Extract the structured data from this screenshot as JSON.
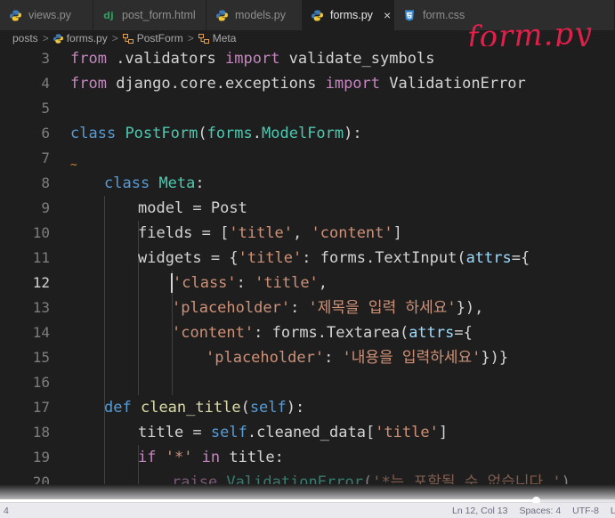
{
  "tabs": [
    {
      "label": "views.py",
      "icon": "python-icon",
      "active": false
    },
    {
      "label": "post_form.html",
      "icon": "django-icon",
      "icon_text": "dj",
      "active": false
    },
    {
      "label": "models.py",
      "icon": "python-icon",
      "active": false
    },
    {
      "label": "forms.py",
      "icon": "python-icon",
      "active": true,
      "close": "×"
    },
    {
      "label": "form.css",
      "icon": "css-icon",
      "active": false
    }
  ],
  "breadcrumb": {
    "items": [
      "posts",
      "forms.py",
      "PostForm",
      "Meta"
    ],
    "separator": ">"
  },
  "annotation": "form.py",
  "gutter": {
    "line_numbers": [
      "3",
      "4",
      "5",
      "6",
      "7",
      "8",
      "9",
      "10",
      "11",
      "12",
      "13",
      "14",
      "15",
      "16",
      "17",
      "18",
      "19",
      "20"
    ],
    "current_line": "12"
  },
  "code": {
    "l3": {
      "kw_from": "from",
      "mod": " .validators ",
      "kw_import": "import",
      "name": " validate_symbols"
    },
    "l4": {
      "kw_from": "from",
      "mod": " django.core.exceptions ",
      "kw_import": "import",
      "name": " ValidationError"
    },
    "l6": {
      "kw": "class",
      "name": "PostForm",
      "p1": "(",
      "base_mod": "forms",
      "dot": ".",
      "base": "ModelForm",
      "p2": "):"
    },
    "l7": {
      "marker": "~"
    },
    "l8": {
      "kw": "class",
      "name": "Meta",
      "colon": ":"
    },
    "l9": {
      "var": "model",
      "eq": " = ",
      "val": "Post"
    },
    "l10": {
      "var": "fields",
      "eq": " = [",
      "s1": "'title'",
      "comma": ", ",
      "s2": "'content'",
      "end": "]"
    },
    "l11": {
      "var": "widgets",
      "eq": " = {",
      "s1": "'title'",
      "colon": ": ",
      "mod": "forms",
      "dot": ".",
      "cls": "TextInput",
      "p": "(",
      "arg": "attrs",
      "end": "={"
    },
    "l12": {
      "s1": "'class'",
      "colon": ": ",
      "s2": "'title'",
      "end": ","
    },
    "l13": {
      "s1": "'placeholder'",
      "colon": ": ",
      "s2": "'제목을 입력 하세요'",
      "end": "}),"
    },
    "l14": {
      "s1": "'content'",
      "colon": ": ",
      "mod": "forms",
      "dot": ".",
      "cls": "Textarea",
      "p": "(",
      "arg": "attrs",
      "end": "={"
    },
    "l15": {
      "s1": "'placeholder'",
      "colon": ": ",
      "s2": "'내용을 입력하세요'",
      "end": "})}"
    },
    "l17": {
      "kw": "def",
      "fn": "clean_title",
      "p1": "(",
      "self": "self",
      "p2": "):"
    },
    "l18": {
      "var": "title",
      "eq": " = ",
      "self": "self",
      "dot": ".",
      "attr": "cleaned_data",
      "b1": "[",
      "s1": "'title'",
      "b2": "]"
    },
    "l19": {
      "kw": "if",
      "s1": " '*' ",
      "kw2": "in",
      "rest": " title:"
    },
    "l20": {
      "fn": "raise",
      "cls": " ValidationError",
      "p": "(",
      "s1": "'*는 포함될 수 없습니다.'",
      "end": ")"
    }
  },
  "statusbar": {
    "left": "4",
    "position": "Ln 12, Col 13",
    "spaces": "Spaces: 4",
    "encoding": "UTF-8",
    "eol": "LF"
  },
  "colors": {
    "keyword_import": "#c586c0",
    "keyword": "#569cd6",
    "class": "#4ec9b0",
    "function": "#dcdcaa",
    "string": "#ce9178",
    "variable": "#9cdcfe",
    "annotation": "#e0204a"
  },
  "video": {
    "progress": 0.873
  }
}
